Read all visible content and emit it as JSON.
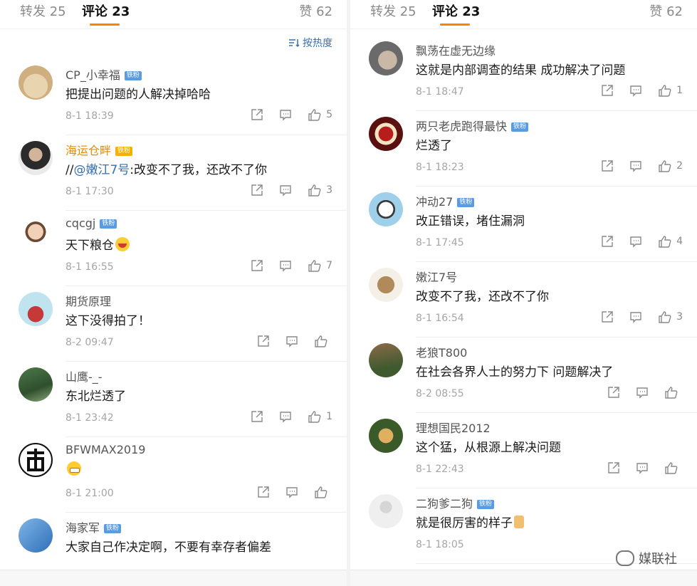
{
  "left": {
    "tabs": {
      "repost": "转发 25",
      "comment": "评论 23",
      "like": "赞 62"
    },
    "sort_label": "按热度",
    "comments": [
      {
        "user": "CP_小幸福",
        "badge": "铁粉",
        "text": "把提出问题的人解决掉哈哈",
        "time": "8-1 18:39",
        "likes": "5"
      },
      {
        "user": "海运仓畔",
        "badge": "铁粉",
        "text_prefix": "//",
        "mention": "@嫩江7号",
        "text": ":改变不了我，还改不了你",
        "time": "8-1 17:30",
        "likes": "3"
      },
      {
        "user": "cqcgj",
        "badge": "铁粉",
        "text": "天下粮仓",
        "time": "8-1 16:55",
        "likes": "7"
      },
      {
        "user": "期货原理",
        "badge": "",
        "text": "这下没得拍了！",
        "time": "8-2 09:47",
        "likes": ""
      },
      {
        "user": "山鹰-_-",
        "badge": "",
        "text": "东北烂透了",
        "time": "8-1 23:42",
        "likes": "1"
      },
      {
        "user": "BFWMAX2019",
        "badge": "",
        "text": "",
        "time": "8-1 21:00",
        "likes": ""
      },
      {
        "user": "海家军",
        "badge": "铁粉",
        "text": "大家自己作决定啊，不要有幸存者偏差",
        "time": "",
        "likes": ""
      }
    ]
  },
  "right": {
    "tabs": {
      "repost": "转发 25",
      "comment": "评论 23",
      "like": "赞 62"
    },
    "comments": [
      {
        "user": "飘荡在虚无边缘",
        "badge": "",
        "text": "这就是内部调查的结果 成功解决了问题",
        "time": "8-1 18:47",
        "likes": "1"
      },
      {
        "user": "两只老虎跑得最快",
        "badge": "铁粉",
        "text": "烂透了",
        "time": "8-1 18:23",
        "likes": "2"
      },
      {
        "user": "冲动27",
        "badge": "铁粉",
        "text": "改正错误，堵住漏洞",
        "time": "8-1 17:45",
        "likes": "4"
      },
      {
        "user": "嫩江7号",
        "badge": "",
        "text": "改变不了我，还改不了你",
        "time": "8-1 16:54",
        "likes": "3"
      },
      {
        "user": "老狼T800",
        "badge": "",
        "text": "在社会各界人士的努力下 问题解决了",
        "time": "8-2 08:55",
        "likes": ""
      },
      {
        "user": "理想国民2012",
        "badge": "",
        "text": "这个猛，从根源上解决问题",
        "time": "8-1 22:43",
        "likes": ""
      },
      {
        "user": "二狗爹二狗",
        "badge": "铁粉",
        "text": "就是很厉害的样子",
        "time": "8-1 18:05",
        "likes": ""
      }
    ]
  },
  "watermark": "媒联社",
  "colors": {
    "accent": "#ff8200",
    "link": "#3a6fb0",
    "badge": "#5b9be0",
    "gold_name": "#e58a00"
  }
}
